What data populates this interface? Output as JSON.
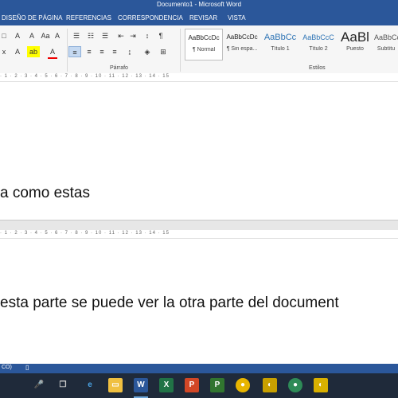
{
  "window": {
    "title": "Documento1 - Microsoft Word"
  },
  "ribbon": {
    "tabs": [
      "DISEÑO DE PÁGINA",
      "REFERENCIAS",
      "CORRESPONDENCIA",
      "REVISAR",
      "VISTA"
    ],
    "groups": {
      "paragraph": "Párrafo",
      "styles": "Estilos"
    },
    "styles": [
      {
        "preview": "AaBbCcDc",
        "name": "¶ Normal"
      },
      {
        "preview": "AaBbCcDc",
        "name": "¶ Sin espa..."
      },
      {
        "preview": "AaBbCc",
        "name": "Título 1"
      },
      {
        "preview": "AaBbCcC",
        "name": "Título 2"
      },
      {
        "preview": "AaBl",
        "name": "Puesto"
      },
      {
        "preview": "AaBbCcD",
        "name": "Subtítu"
      }
    ]
  },
  "ruler": {
    "marks": "· 1 · 2 · 3 · 4 · 5 · 6 · 7 · 8 · 9 · 10 · 11 · 12 · 13 · 14 · 15"
  },
  "document": {
    "line1": "a como estas",
    "line2": "esta parte se puede ver la otra parte del document"
  },
  "statusbar": {
    "text": "CO)"
  },
  "colors": {
    "brand": "#2b579a",
    "taskbar": "#1f2a3a"
  }
}
